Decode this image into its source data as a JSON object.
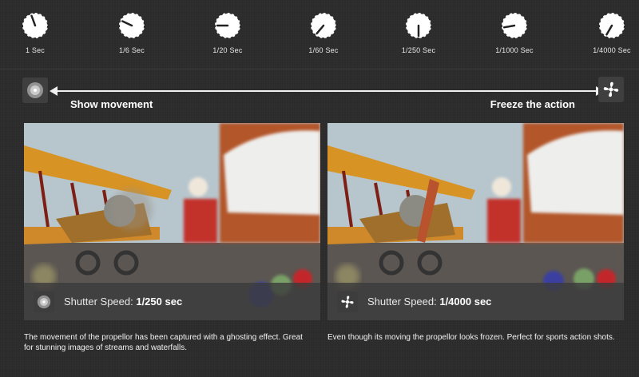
{
  "dials": [
    {
      "label": "1 Sec",
      "angle": -20
    },
    {
      "label": "1/6 Sec",
      "angle": -65
    },
    {
      "label": "1/20 Sec",
      "angle": -90
    },
    {
      "label": "1/60 Sec",
      "angle": -140
    },
    {
      "label": "1/250 Sec",
      "angle": 180
    },
    {
      "label": "1/1000 Sec",
      "angle": -100
    },
    {
      "label": "1/4000 Sec",
      "angle": -150
    }
  ],
  "scale": {
    "left_label": "Show movement",
    "right_label": "Freeze the action",
    "left_icon": "blurred-propeller-icon",
    "right_icon": "frozen-propeller-icon"
  },
  "panels": [
    {
      "caption_prefix": "Shutter Speed: ",
      "caption_value": "1/250 sec",
      "icon": "blurred-propeller-icon",
      "description": "The movement of the propellor has been captured with a ghosting effect. Great for stunning images of streams and waterfalls."
    },
    {
      "caption_prefix": "Shutter Speed: ",
      "caption_value": "1/4000 sec",
      "icon": "frozen-propeller-icon",
      "description": "Even though its moving the propellor looks frozen. Perfect for sports action shots."
    }
  ]
}
